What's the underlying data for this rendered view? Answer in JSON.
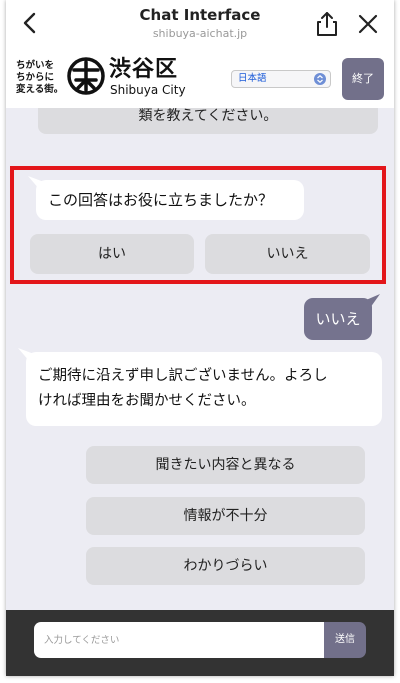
{
  "browser": {
    "title": "Chat Interface",
    "url": "shibuya-aichat.jp"
  },
  "header": {
    "tagline": [
      "ちがいを",
      "ちからに",
      "変える街。"
    ],
    "city_name_jp": "渋谷区",
    "city_name_en": "Shibuya City",
    "language_selected": "日本語",
    "end_label": "終了"
  },
  "chat": {
    "previous_option": "類を教えてください。",
    "feedback_question": "この回答はお役に立ちましたか？",
    "feedback_yes": "はい",
    "feedback_no": "いいえ",
    "user_reply": "いいえ",
    "bot_apology_line1": "ご期待に沿えず申し訳ございません。よろし",
    "bot_apology_line2": "ければ理由をお聞かせください。",
    "reasons": [
      "聞きたい内容と異なる",
      "情報が不十分",
      "わかりづらい"
    ]
  },
  "input": {
    "placeholder": "入力してください",
    "send_label": "送信"
  },
  "colors": {
    "accent": "#72708a",
    "highlight": "#e3161a",
    "chat_background": "#ececf3"
  }
}
